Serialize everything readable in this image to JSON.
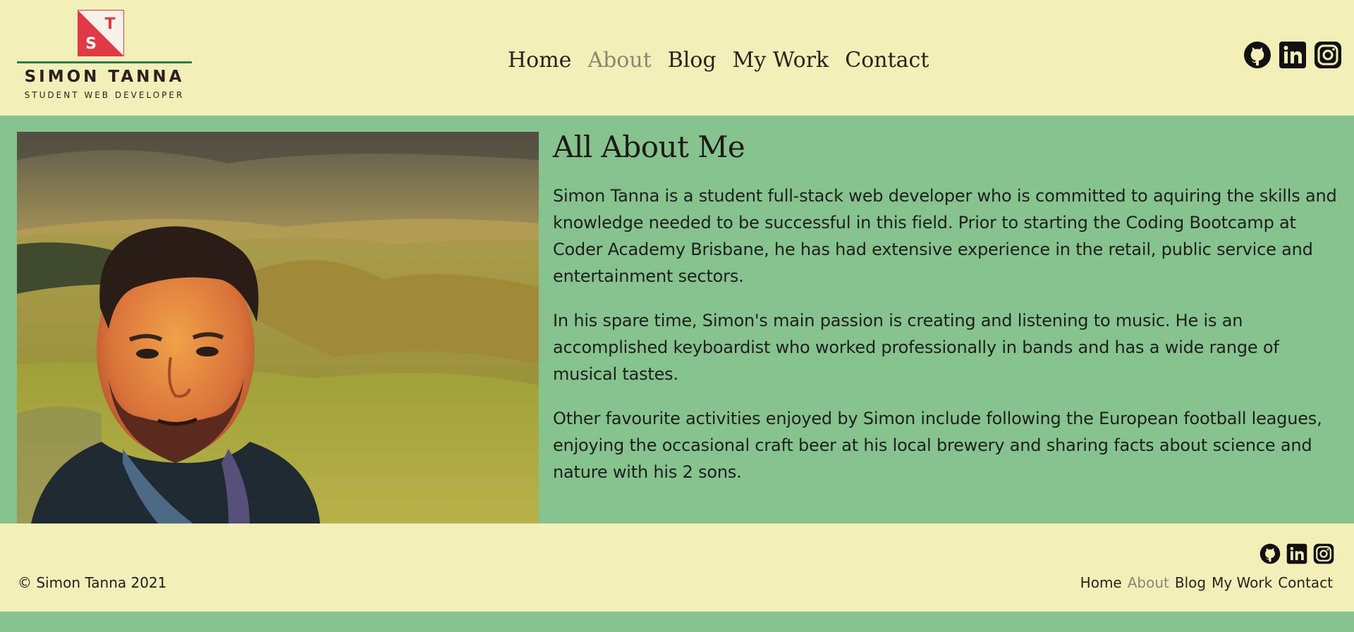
{
  "brand": {
    "name": "SIMON TANNA",
    "tagline": "STUDENT WEB DEVELOPER",
    "logo_letters": [
      "S",
      "T"
    ],
    "accent_color": "#e03a45",
    "rule_color": "#2f7a4d"
  },
  "nav": {
    "items": [
      {
        "label": "Home",
        "active": false
      },
      {
        "label": "About",
        "active": true
      },
      {
        "label": "Blog",
        "active": false
      },
      {
        "label": "My Work",
        "active": false
      },
      {
        "label": "Contact",
        "active": false
      }
    ]
  },
  "social": {
    "icons": [
      "github-icon",
      "linkedin-icon",
      "instagram-icon"
    ]
  },
  "about": {
    "title": "All About Me",
    "paragraphs": [
      "Simon Tanna is a student full-stack web developer who is committed to aquiring the skills and knowledge needed to be successful in this field. Prior to starting the Coding Bootcamp at Coder Academy Brisbane, he has had extensive experience in the retail, public service and entertainment sectors.",
      "In his spare time, Simon's main passion is creating and listening to music. He is an accomplished keyboardist who worked professionally in bands and has a wide range of musical tastes.",
      "Other favourite activities enjoyed by Simon include following the European football leagues, enjoying the occasional craft beer at his local brewery and sharing facts about science and nature with his 2 sons."
    ]
  },
  "footer": {
    "copyright": "© Simon Tanna 2021"
  },
  "colors": {
    "header_bg": "#f3efb8",
    "content_bg": "#86c38e",
    "active_link": "#8c8574"
  }
}
